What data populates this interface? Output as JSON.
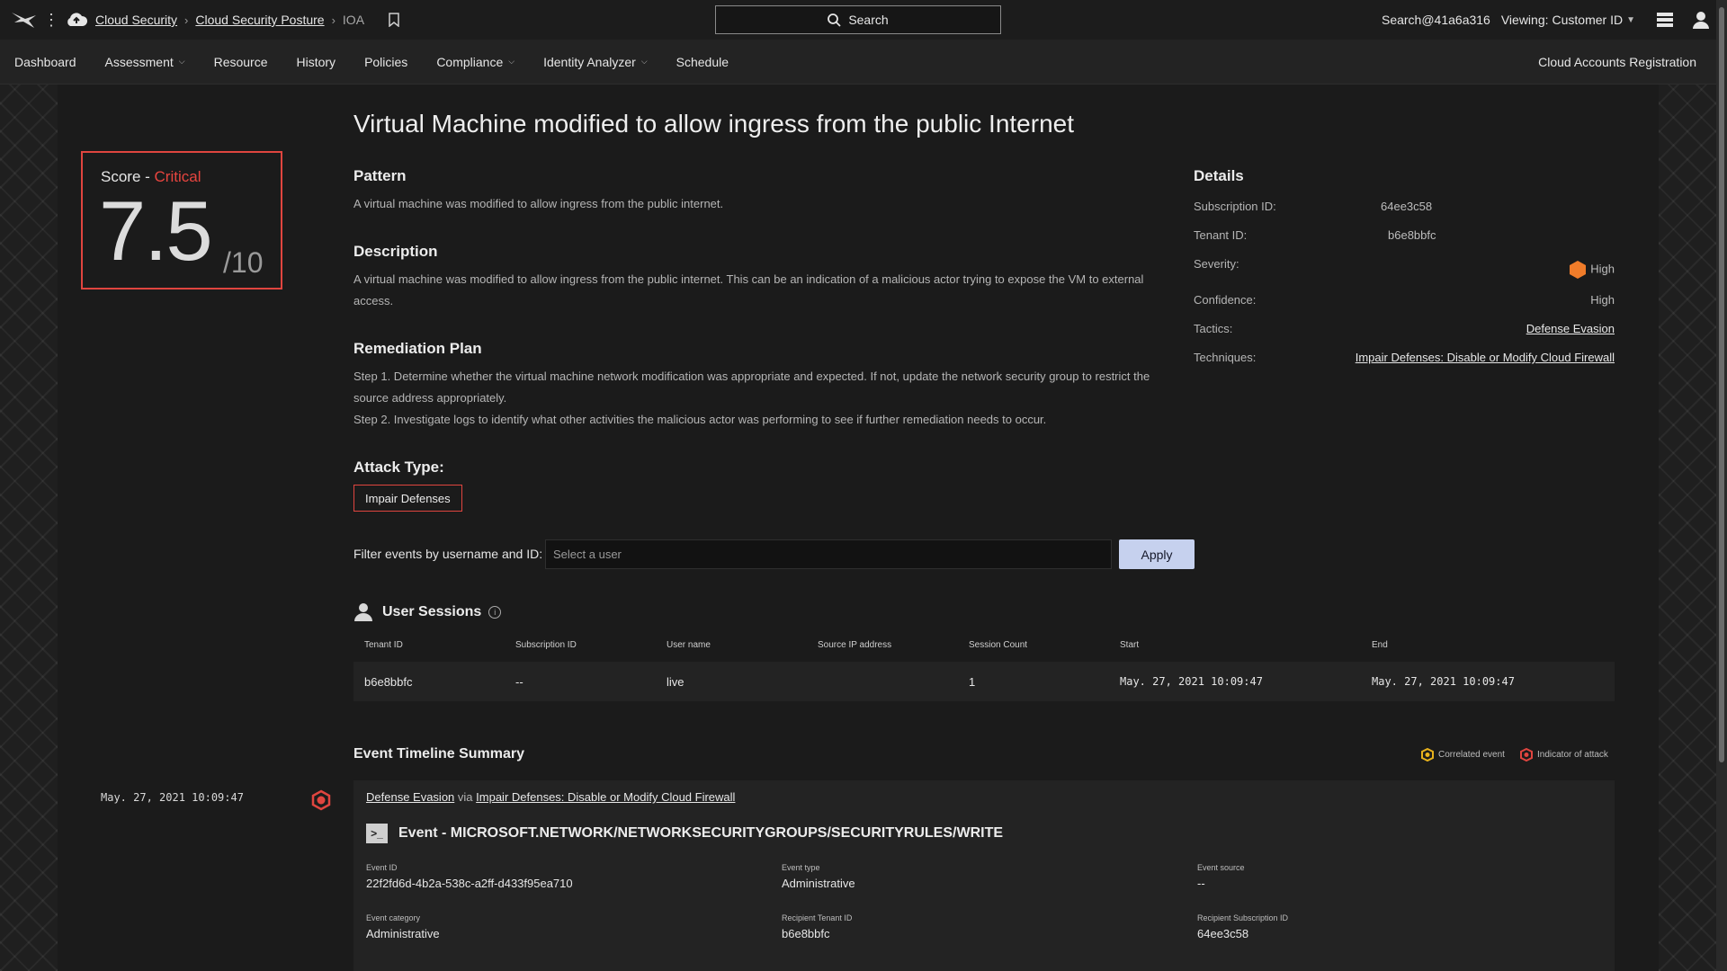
{
  "topbar": {
    "breadcrumbs": [
      "Cloud Security",
      "Cloud Security Posture"
    ],
    "current": "IOA",
    "search_label": "Search",
    "user": "Search@41a6a316",
    "viewing_label": "Viewing:",
    "viewing_value": "Customer ID"
  },
  "nav": {
    "items": [
      {
        "label": "Dashboard",
        "dropdown": false
      },
      {
        "label": "Assessment",
        "dropdown": true
      },
      {
        "label": "Resource",
        "dropdown": false
      },
      {
        "label": "History",
        "dropdown": false
      },
      {
        "label": "Policies",
        "dropdown": false
      },
      {
        "label": "Compliance",
        "dropdown": true
      },
      {
        "label": "Identity Analyzer",
        "dropdown": true
      },
      {
        "label": "Schedule",
        "dropdown": false
      }
    ],
    "right": "Cloud Accounts Registration"
  },
  "score": {
    "label": "Score - ",
    "level": "Critical",
    "value": "7.5",
    "max": "/10"
  },
  "title": "Virtual Machine modified to allow ingress from the public Internet",
  "pattern": {
    "heading": "Pattern",
    "text": "A virtual machine was modified to allow ingress from the public internet."
  },
  "description": {
    "heading": "Description",
    "text": "A virtual machine was modified to allow ingress from the public internet. This can be an indication of a malicious actor trying to expose the VM to external access."
  },
  "remediation": {
    "heading": "Remediation Plan",
    "step1": "Step 1. Determine whether the virtual machine network modification was appropriate and expected. If not, update the network security group to restrict the source address appropriately.",
    "step2": "Step 2. Investigate logs to identify what other activities the malicious actor was performing to see if further remediation needs to occur."
  },
  "attack_type": {
    "heading": "Attack Type:",
    "value": "Impair Defenses"
  },
  "details": {
    "heading": "Details",
    "subscription_label": "Subscription ID:",
    "subscription": "64ee3c58",
    "tenant_label": "Tenant ID:",
    "tenant": "b6e8bbfc",
    "severity_label": "Severity:",
    "severity": "High",
    "severity_color": "#f07c2a",
    "confidence_label": "Confidence:",
    "confidence": "High",
    "tactics_label": "Tactics:",
    "tactics": "Defense Evasion",
    "techniques_label": "Techniques:",
    "techniques": "Impair Defenses: Disable or Modify Cloud Firewall"
  },
  "filter": {
    "label": "Filter events by username and ID:",
    "placeholder": "Select a user",
    "apply": "Apply"
  },
  "sessions": {
    "heading": "User Sessions",
    "columns": [
      "Tenant ID",
      "Subscription ID",
      "User name",
      "Source IP address",
      "Session Count",
      "Start",
      "End"
    ],
    "rows": [
      [
        "b6e8bbfc",
        "--",
        "live",
        "",
        "1",
        "May. 27, 2021 10:09:47",
        "May. 27, 2021 10:09:47"
      ]
    ]
  },
  "timeline": {
    "heading": "Event Timeline Summary",
    "legend": [
      {
        "label": "Correlated event",
        "color": "#e8b21c"
      },
      {
        "label": "Indicator of attack",
        "color": "#e0453f"
      }
    ],
    "date": "May. 27, 2021 10:09:47",
    "event": {
      "tactic": "Defense Evasion",
      "via": "via",
      "technique": "Impair Defenses: Disable or Modify Cloud Firewall",
      "title": "Event - MICROSOFT.NETWORK/NETWORKSECURITYGROUPS/SECURITYRULES/WRITE",
      "fields": [
        {
          "label": "Event ID",
          "value": "22f2fd6d-4b2a-538c-a2ff-d433f95ea710"
        },
        {
          "label": "Event type",
          "value": "Administrative"
        },
        {
          "label": "Event source",
          "value": "--"
        },
        {
          "label": "Event category",
          "value": "Administrative"
        },
        {
          "label": "Recipient Tenant ID",
          "value": "b6e8bbfc"
        },
        {
          "label": "Recipient Subscription ID",
          "value": "64ee3c58"
        }
      ]
    }
  },
  "colors": {
    "critical": "#e8453f",
    "apply_bg": "#c6d1ee"
  }
}
